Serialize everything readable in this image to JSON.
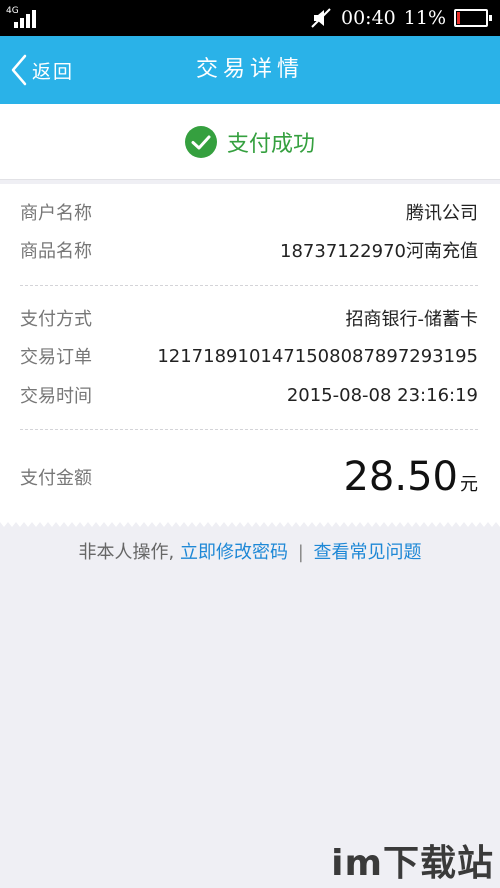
{
  "status_bar": {
    "network": "4G",
    "time": "00:40",
    "battery_text": "11%",
    "battery_level": 0.11,
    "battery_color": "#e8302b",
    "icons": [
      "signal-icon",
      "mute-icon",
      "battery-icon"
    ]
  },
  "nav": {
    "back_label": "返回",
    "title": "交易详情",
    "color": "#2ab2e8"
  },
  "result": {
    "text": "支付成功",
    "icon": "success-check-icon",
    "color": "#35a03f"
  },
  "details": {
    "merchant": {
      "label": "商户名称",
      "value": "腾讯公司"
    },
    "product": {
      "label": "商品名称",
      "value": "18737122970河南充值"
    },
    "payment_method": {
      "label": "支付方式",
      "value": "招商银行-储蓄卡"
    },
    "order_number": {
      "label": "交易订单",
      "value": "1217189101471508087897293195"
    },
    "time": {
      "label": "交易时间",
      "value": "2015-08-08 23:16:19"
    },
    "amount": {
      "label": "支付金额",
      "value": "28.50",
      "unit": "元"
    }
  },
  "footer": {
    "warning": "非本人操作,",
    "change_password": "立即修改密码",
    "separator": "|",
    "faq": "查看常见问题",
    "link_color": "#1e88d6"
  },
  "watermark": {
    "text": "im下载站"
  }
}
